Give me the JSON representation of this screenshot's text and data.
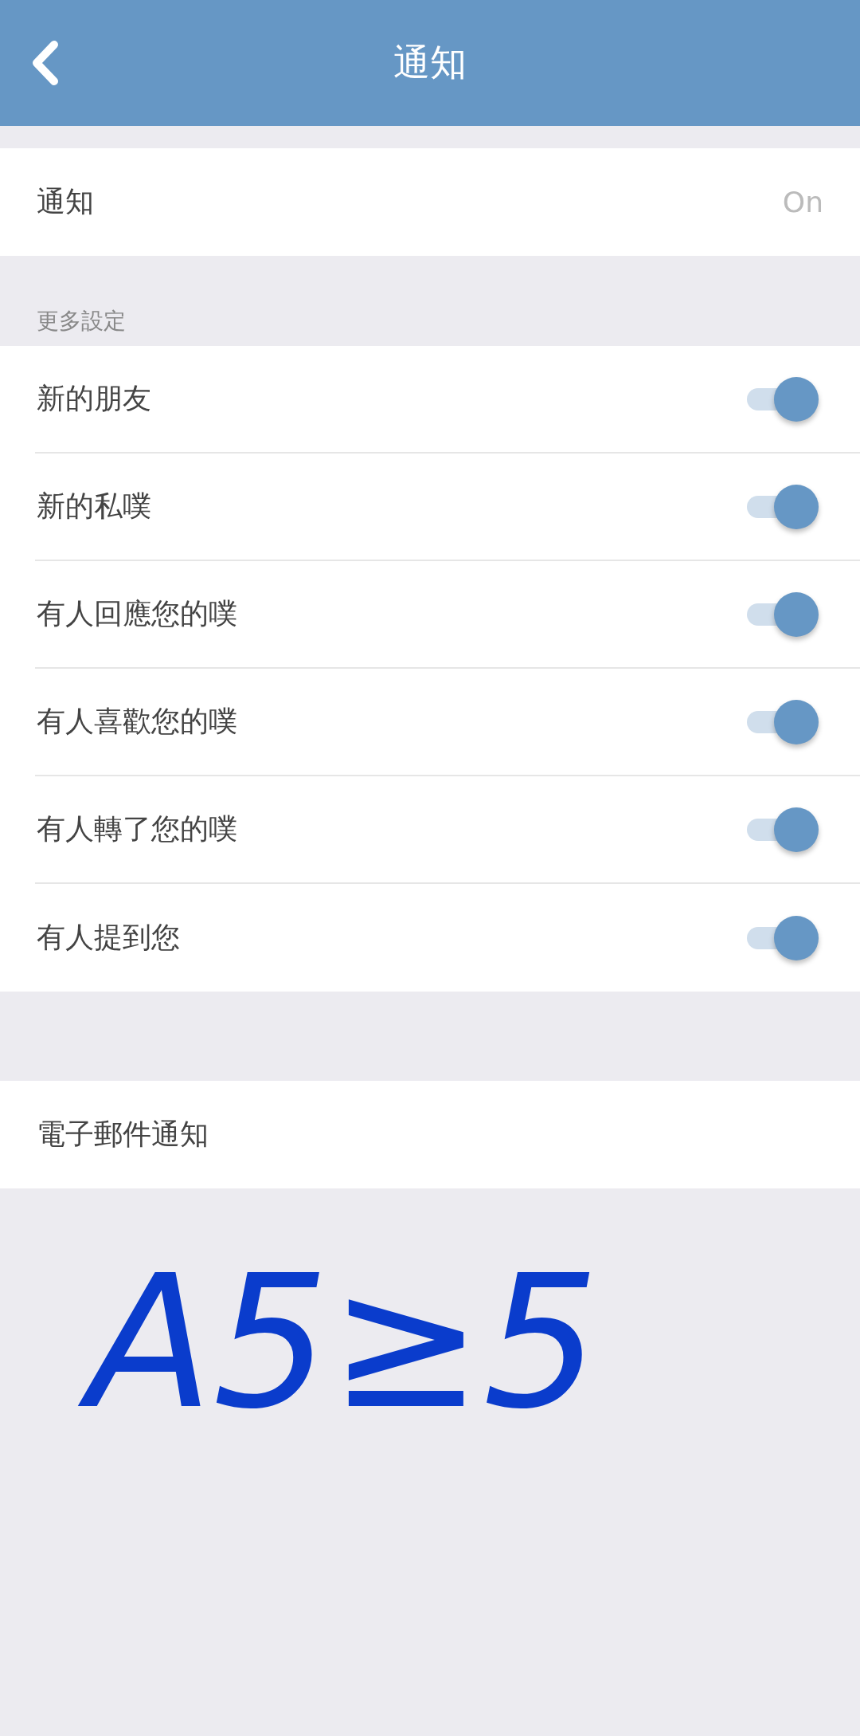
{
  "header": {
    "title": "通知"
  },
  "notification": {
    "label": "通知",
    "value": "On"
  },
  "more_settings": {
    "heading": "更多設定",
    "items": [
      {
        "label": "新的朋友",
        "on": true
      },
      {
        "label": "新的私噗",
        "on": true
      },
      {
        "label": "有人回應您的噗",
        "on": true
      },
      {
        "label": "有人喜歡您的噗",
        "on": true
      },
      {
        "label": "有人轉了您的噗",
        "on": true
      },
      {
        "label": "有人提到您",
        "on": true
      }
    ]
  },
  "email": {
    "label": "電子郵件通知"
  },
  "handwriting": "A5≥5"
}
